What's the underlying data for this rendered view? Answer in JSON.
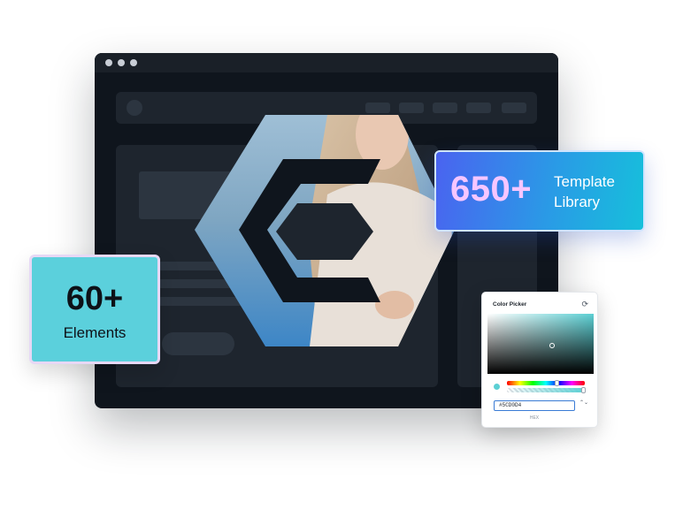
{
  "template_card": {
    "number": "650+",
    "label_line1": "Template",
    "label_line2": "Library"
  },
  "elements_card": {
    "number": "60+",
    "label": "Elements"
  },
  "color_picker": {
    "title": "Color Picker",
    "refresh_icon": "⟳",
    "hex_value": "#5CD0D4",
    "hex_label": "HEX",
    "stepper_icon": "⌃⌄",
    "selected_color": "#5cd0d4"
  },
  "colors": {
    "window_bg": "#0f151d",
    "panel_bg": "#1e252e",
    "elements_card_bg": "#5bd0dc",
    "template_gradient_start": "#4a63f0",
    "template_gradient_end": "#16c0db"
  }
}
